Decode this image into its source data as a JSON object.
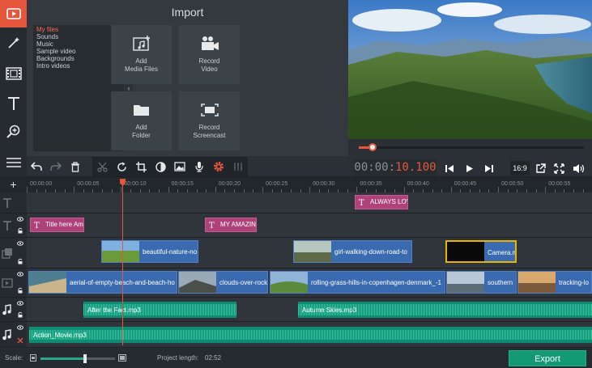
{
  "left_toolbar": {
    "tools": [
      "video-icon",
      "magic-wand-icon",
      "film-strip-icon",
      "title-text-icon",
      "zoom-in-icon",
      "menu-lines-icon"
    ]
  },
  "import_panel": {
    "title": "Import",
    "categories": [
      "My files",
      "Sounds",
      "Music",
      "Sample video",
      "Backgrounds",
      "Intro videos"
    ],
    "selected_category": "My files",
    "tiles": [
      {
        "label": "Add\nMedia Files",
        "icon": "add-media-icon"
      },
      {
        "label": "Record\nVideo",
        "icon": "camera-icon"
      },
      {
        "label": "Add\nFolder",
        "icon": "folder-icon"
      },
      {
        "label": "Record\nScreencast",
        "icon": "screencast-icon"
      }
    ],
    "collapse_glyph": "‹"
  },
  "preview": {
    "seek_progress": 0.06
  },
  "timecode": {
    "dim": "00:00:",
    "active": "10.100"
  },
  "player_controls": {
    "aspect": "16:9"
  },
  "ruler": {
    "labels": [
      "00:00:00",
      "00:00:05",
      "00:00:10",
      "00:00:15",
      "00:00:20",
      "00:00:25",
      "00:00:30",
      "00:00:35",
      "00:00:40",
      "00:00:45",
      "00:00:50",
      "00:00:55"
    ]
  },
  "tracks": {
    "title_clips_upper": [
      {
        "label": "ALWAYS LOVE"
      }
    ],
    "title_clips_lower": [
      {
        "label": "Title here Am"
      },
      {
        "label": "MY AMAZING"
      }
    ],
    "overlay_clips": [
      {
        "label": "beautiful-nature-no"
      },
      {
        "label": "girl-walking-down-road-to"
      },
      {
        "label": "Camera.m"
      }
    ],
    "video_clips": [
      {
        "label": "aerial-of-empty-beach-and-beach-ho"
      },
      {
        "label": "clouds-over-rock"
      },
      {
        "label": "rolling-grass-hills-in-copenhagen-denmark_-1"
      },
      {
        "label": "southern"
      },
      {
        "label": "tracking-lo"
      }
    ],
    "audio_clips": [
      {
        "label": "After the Fact.mp3"
      },
      {
        "label": "Autumn Skies.mp3"
      }
    ],
    "music_clips": [
      {
        "label": "Action_Movie.mp3"
      }
    ]
  },
  "bottom_bar": {
    "scale_label": "Scale:",
    "scale_value": 0.6,
    "project_length_label": "Project length:",
    "project_length": "02:52",
    "export_label": "Export"
  },
  "colors": {
    "accent": "#e4573d",
    "title_clip": "#b0427a",
    "video_clip": "#3a6bb0",
    "audio_clip": "#0e8c74",
    "export": "#139a74"
  }
}
